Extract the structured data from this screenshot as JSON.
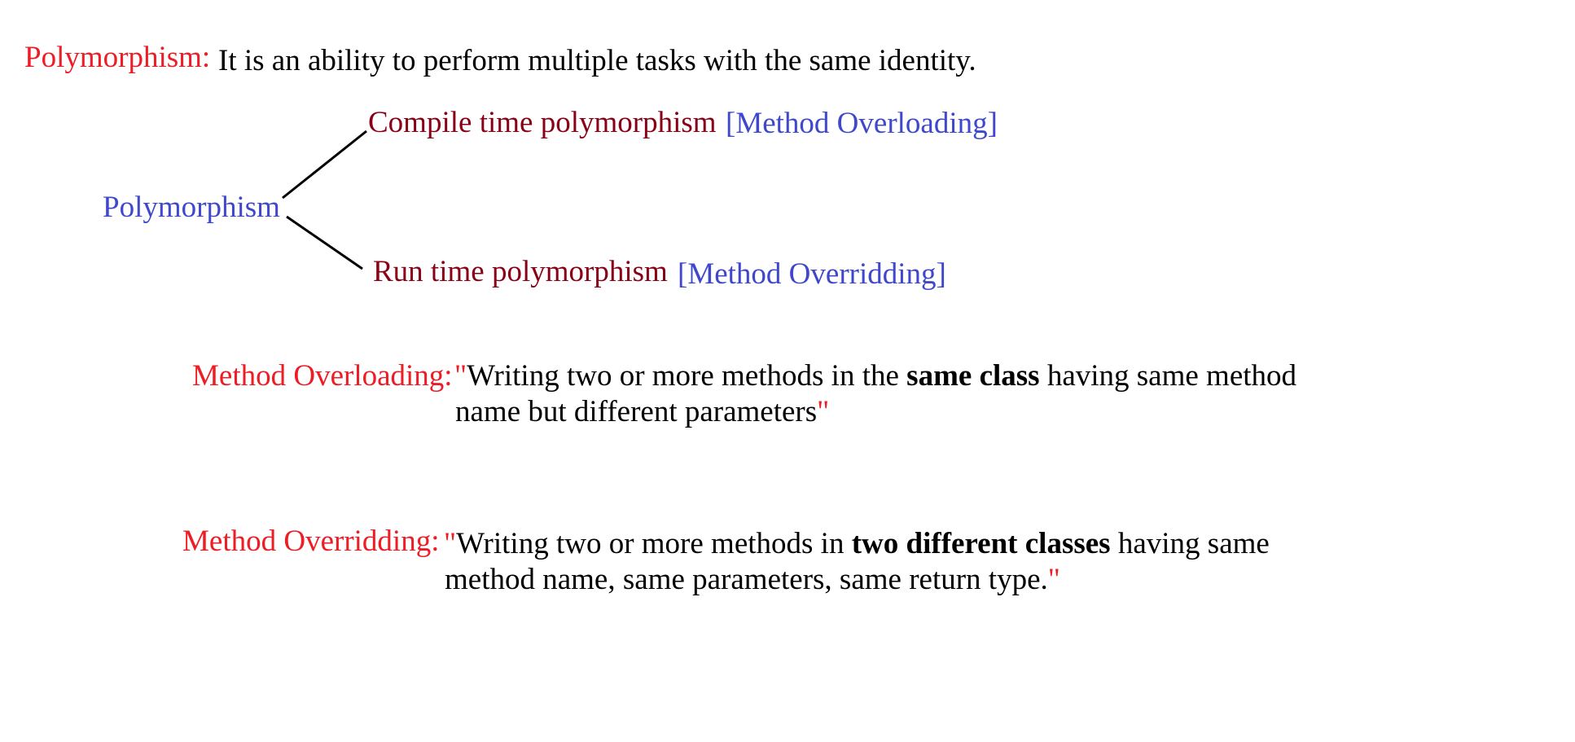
{
  "definition": {
    "term": "Polymorphism:",
    "text": "It is an ability to perform multiple tasks with the same identity."
  },
  "tree": {
    "root": "Polymorphism",
    "branches": [
      {
        "label": "Compile time polymorphism",
        "tag": "[Method Overloading]"
      },
      {
        "label": "Run time polymorphism",
        "tag": "[Method Overridding]"
      }
    ]
  },
  "overloading": {
    "term": "Method Overloading:",
    "open_quote": "\"",
    "line1_before": "Writing two or more methods in the ",
    "line1_bold": "same class",
    "line1_after": " having same method",
    "line2": "name but different parameters",
    "close_quote": "\""
  },
  "overriding": {
    "term": "Method Overridding:",
    "open_quote": "\"",
    "line1_before": "Writing two or more methods in ",
    "line1_bold": "two different classes",
    "line1_after": " having same",
    "line2": "method name, same parameters, same return type.",
    "close_quote": "\""
  },
  "colors": {
    "term_red": "#ee1c24",
    "tree_blue": "#3f48cc",
    "branch_maroon": "#880015",
    "text_black": "#000000"
  }
}
